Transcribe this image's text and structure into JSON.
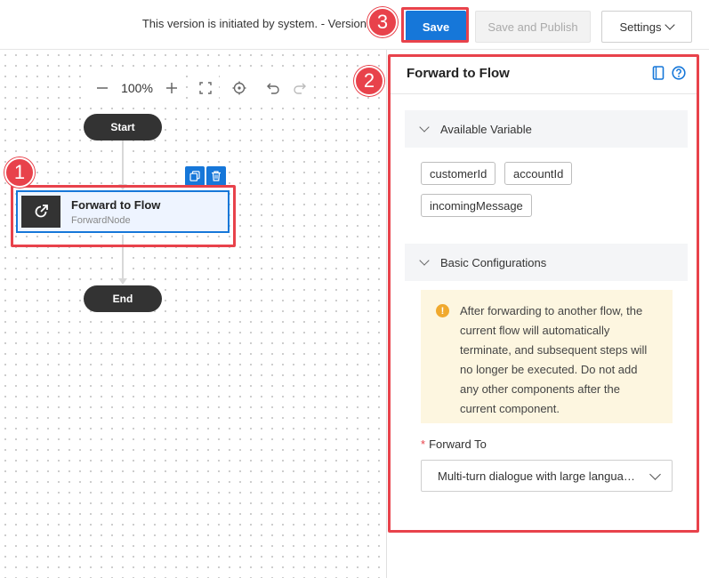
{
  "topbar": {
    "version_text": "This version is initiated by system. - Version",
    "save_label": "Save",
    "publish_label": "Save and Publish",
    "settings_label": "Settings"
  },
  "canvas": {
    "zoom": "100%",
    "start_label": "Start",
    "end_label": "End",
    "node": {
      "title": "Forward to Flow",
      "subtitle": "ForwardNode"
    }
  },
  "panel": {
    "title": "Forward to Flow",
    "available_variable": {
      "title": "Available Variable",
      "tags": [
        "customerId",
        "accountId",
        "incomingMessage"
      ]
    },
    "basic_config": {
      "title": "Basic Configurations",
      "warning": "After forwarding to another flow, the current flow will automatically terminate, and subsequent steps will no longer be executed. Do not add any other components after the current component.",
      "forward_to_label": "Forward To",
      "forward_to_value": "Multi-turn dialogue with large language model"
    }
  },
  "annotations": {
    "badge_1": "1",
    "badge_2": "2",
    "badge_3": "3"
  },
  "colors": {
    "primary": "#1677d9",
    "annotation_red": "#e8424b",
    "warning_bg": "#fdf6e0",
    "warning_icon": "#f0a92e"
  }
}
